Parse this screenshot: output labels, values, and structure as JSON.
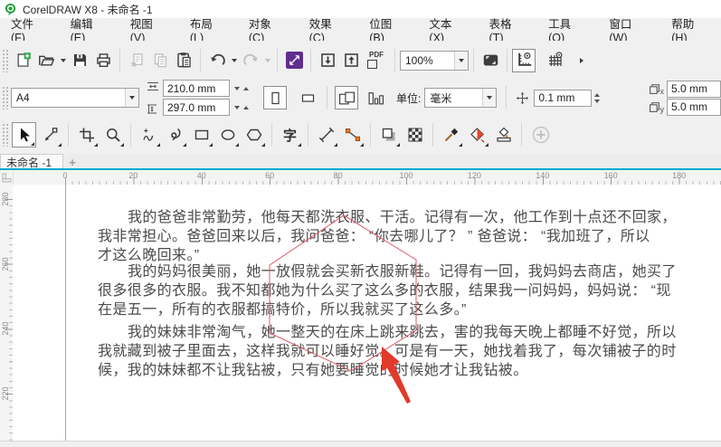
{
  "window": {
    "title": "CorelDRAW X8 - 未命名 -1"
  },
  "menu": {
    "items": [
      "文件(F)",
      "编辑(E)",
      "视图(V)",
      "布局(L)",
      "对象(C)",
      "效果(C)",
      "位图(B)",
      "文本(X)",
      "表格(T)",
      "工具(O)",
      "窗口(W)",
      "帮助(H)"
    ]
  },
  "toolbar": {
    "zoom_level": "100%",
    "pdf_label": "PDF"
  },
  "property_bar": {
    "page_preset": "A4",
    "page_width": "210.0 mm",
    "page_height": "297.0 mm",
    "units_label": "单位:",
    "units_value": "毫米",
    "nudge_offset": "0.1 mm",
    "duplicate_x": "5.0 mm",
    "duplicate_y": "5.0 mm",
    "dup_x_sub": "x",
    "dup_y_sub": "y"
  },
  "toolbox": {
    "text_tool_glyph": "字"
  },
  "tabs": {
    "active": "未命名 -1",
    "new_tab": "+"
  },
  "rulers": {
    "horizontal": [
      "0",
      "20",
      "40",
      "60",
      "80",
      "100",
      "120",
      "140",
      "160",
      "180"
    ],
    "vertical": [
      "280",
      "260",
      "240",
      "220"
    ]
  },
  "document_text": {
    "paragraphs": [
      {
        "lines": [
          "我的爸爸非常勤劳，他每天都洗衣服、干活。记得有一次，他工作到十点还不回家，",
          "我非常担心。爸爸回来以后，我问爸爸： “你去哪儿了？ ” 爸爸说： “我加班了，所以",
          "才这么晚回来。”"
        ]
      },
      {
        "lines": [
          "我的妈妈很美丽，她一放假就会买新衣服新鞋。记得有一回，我妈妈去商店，她买了",
          "很多很多的衣服。我不知都她为什么买了这么多的衣服，结果我一问妈妈，妈妈说： “现",
          "在是五一，所有的衣服都搞特价，所以我就买了这么多。”"
        ]
      },
      {
        "lines": [
          "我的妹妹非常淘气，她一整天的在床上跳来跳去，害的我每天晚上都睡不好觉，所以",
          "我就藏到被子里面去，这样我就可以睡好觉。可是有一天，她找着我了，每次铺被子的时",
          "候，我的妹妹都不让我钻被，只有她要睡觉的时候她才让我钻被。"
        ]
      }
    ]
  },
  "colors": {
    "accent_teal": "#00a9ce",
    "annotation_arrow_red": "#e23a2b",
    "annotation_outline_red": "#dd5b68",
    "logo_green": "#21a038"
  }
}
